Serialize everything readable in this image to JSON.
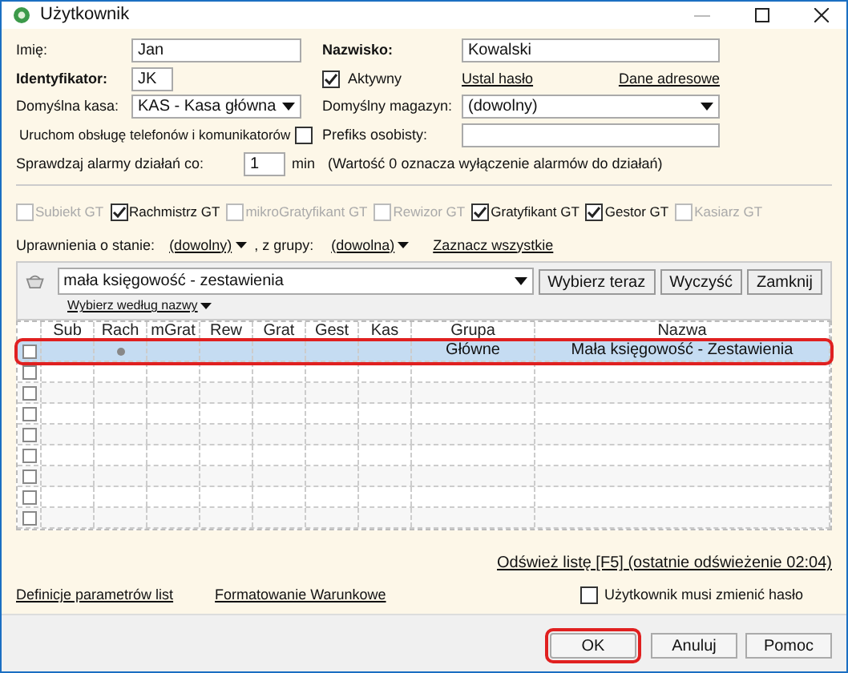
{
  "window": {
    "title": "Użytkownik"
  },
  "form": {
    "imie_label": "Imię:",
    "imie": "Jan",
    "nazwisko_label": "Nazwisko:",
    "nazwisko": "Kowalski",
    "identyfikator_label": "Identyfikator:",
    "identyfikator": "JK",
    "aktywny_label": "Aktywny",
    "aktywny": true,
    "ustal_haslo": "Ustal hasło",
    "dane_adresowe": "Dane adresowe",
    "kasa_label": "Domyślna kasa:",
    "kasa": "KAS - Kasa główna",
    "magazyn_label": "Domyślny magazyn:",
    "magazyn": "(dowolny)",
    "uruchom_label": "Uruchom obsługę telefonów i komunikatorów",
    "uruchom": false,
    "prefiks_label": "Prefiks osobisty:",
    "alarm_label": "Sprawdzaj alarmy działań co:",
    "alarm": "1",
    "alarm_unit": "min",
    "alarm_note": "(Wartość 0 oznacza wyłączenie alarmów do działań)"
  },
  "modules": [
    {
      "label": "Subiekt GT",
      "checked": false,
      "disabled": true
    },
    {
      "label": "Rachmistrz GT",
      "checked": true,
      "disabled": false
    },
    {
      "label": "mikroGratyfikant GT",
      "checked": false,
      "disabled": true
    },
    {
      "label": "Rewizor GT",
      "checked": false,
      "disabled": true
    },
    {
      "label": "Gratyfikant GT",
      "checked": true,
      "disabled": false
    },
    {
      "label": "Gestor GT",
      "checked": true,
      "disabled": false
    },
    {
      "label": "Kasiarz GT",
      "checked": false,
      "disabled": true
    }
  ],
  "permissions": {
    "stan_label": "Uprawnienia o stanie:",
    "stan": "(dowolny)",
    "grupa_label": ", z grupy:",
    "grupa": "(dowolna)",
    "zaznacz": "Zaznacz wszystkie"
  },
  "filter": {
    "value": "mała księgowość - zestawienia",
    "buttons": [
      "Wybierz teraz",
      "Wyczyść",
      "Zamknij"
    ],
    "by_name": "Wybierz według nazwy"
  },
  "table": {
    "columns": [
      "Sub",
      "Rach",
      "mGrat",
      "Rew",
      "Grat",
      "Gest",
      "Kas",
      "Grupa",
      "Nazwa"
    ],
    "rows": [
      {
        "selected": true,
        "checked": false,
        "dots": [
          false,
          true,
          false,
          false,
          false,
          false,
          false
        ],
        "grupa": "Główne",
        "nazwa": "Mała księgowość - Zestawienia"
      },
      {
        "selected": false,
        "checked": false
      },
      {
        "selected": false,
        "checked": false
      },
      {
        "selected": false,
        "checked": false
      },
      {
        "selected": false,
        "checked": false
      },
      {
        "selected": false,
        "checked": false
      },
      {
        "selected": false,
        "checked": false
      },
      {
        "selected": false,
        "checked": false
      },
      {
        "selected": false,
        "checked": false
      }
    ]
  },
  "refresh": "Odśwież listę [F5] (ostatnie odświeżenie 02:04)",
  "links": [
    "Definicje parametrów list",
    "Formatowanie Warunkowe"
  ],
  "must_change": {
    "label": "Użytkownik musi zmienić hasło",
    "checked": false
  },
  "buttons": [
    {
      "label": "OK",
      "highlighted": true
    },
    {
      "label": "Anuluj",
      "highlighted": false
    },
    {
      "label": "Pomoc",
      "highlighted": false
    }
  ]
}
